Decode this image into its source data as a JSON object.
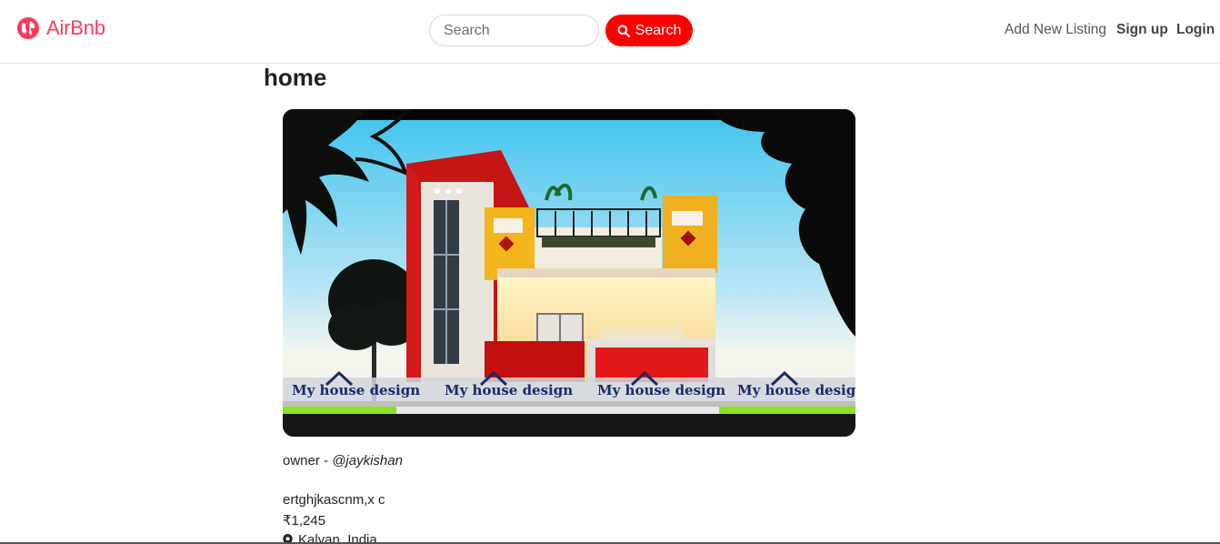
{
  "brand": {
    "name": "AirBnb",
    "icon": "compass-icon",
    "color": "#ff385c"
  },
  "search": {
    "placeholder": "Search",
    "button_label": "Search",
    "button_icon": "search-icon",
    "button_color": "#fe0000"
  },
  "nav": {
    "add_listing": "Add New Listing",
    "signup": "Sign up",
    "login": "Login"
  },
  "listing": {
    "title": "home",
    "image_alt": "house",
    "watermark": "My house design",
    "owner_prefix": "owner - ",
    "owner_handle": "@jaykishan",
    "description": "ertghjkascnm,x c",
    "price": "₹1,245",
    "location": "Kalyan, India",
    "location_icon": "map-pin-icon"
  }
}
